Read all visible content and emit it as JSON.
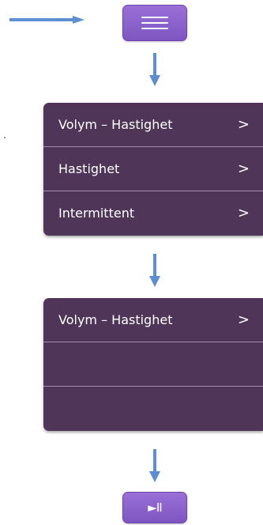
{
  "top_arrow_icon": "right-arrow-icon",
  "menu_button": {
    "icon": "list-icon"
  },
  "panel1": {
    "items": [
      {
        "label": "Volym – Hastighet",
        "chevron": ">"
      },
      {
        "label": "Hastighet",
        "chevron": ">"
      },
      {
        "label": "Intermittent",
        "chevron": ">"
      }
    ]
  },
  "panel2": {
    "items": [
      {
        "label": "Volym – Hastighet",
        "chevron": ">"
      },
      {
        "label": "",
        "chevron": ""
      },
      {
        "label": "",
        "chevron": ""
      }
    ]
  },
  "play_button": {
    "label": "►II"
  },
  "colors": {
    "button_purple": "#8a60cc",
    "panel_purple": "#4f3557",
    "arrow_blue": "#5b8fd1"
  }
}
